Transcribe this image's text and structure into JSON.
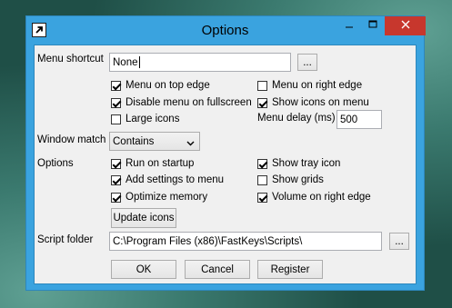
{
  "window": {
    "title": "Options",
    "titlebar_color": "#3aa3df",
    "close_color": "#c7372d"
  },
  "menu_shortcut": {
    "label": "Menu shortcut",
    "value": "None",
    "browse_label": "..."
  },
  "menu_options": {
    "menu_on_top_edge": {
      "label": "Menu on top edge",
      "checked": true
    },
    "menu_on_right_edge": {
      "label": "Menu on right edge",
      "checked": false
    },
    "disable_menu_fullscreen": {
      "label": "Disable menu on fullscreen",
      "checked": true
    },
    "show_icons_on_menu": {
      "label": "Show icons on menu",
      "checked": true
    },
    "large_icons": {
      "label": "Large icons",
      "checked": false
    },
    "menu_delay_label": "Menu delay (ms)",
    "menu_delay_value": "500"
  },
  "window_match": {
    "label": "Window match",
    "selected": "Contains"
  },
  "options": {
    "label": "Options",
    "run_on_startup": {
      "label": "Run on startup",
      "checked": true
    },
    "show_tray_icon": {
      "label": "Show tray icon",
      "checked": true
    },
    "add_settings_to_menu": {
      "label": "Add settings to menu",
      "checked": true
    },
    "show_grids": {
      "label": "Show grids",
      "checked": false
    },
    "optimize_memory": {
      "label": "Optimize memory",
      "checked": true
    },
    "volume_on_right_edge": {
      "label": "Volume on right edge",
      "checked": true
    },
    "update_icons_label": "Update icons"
  },
  "script_folder": {
    "label": "Script folder",
    "value": "C:\\Program Files (x86)\\FastKeys\\Scripts\\",
    "browse_label": "..."
  },
  "footer": {
    "ok_label": "OK",
    "cancel_label": "Cancel",
    "register_label": "Register"
  }
}
